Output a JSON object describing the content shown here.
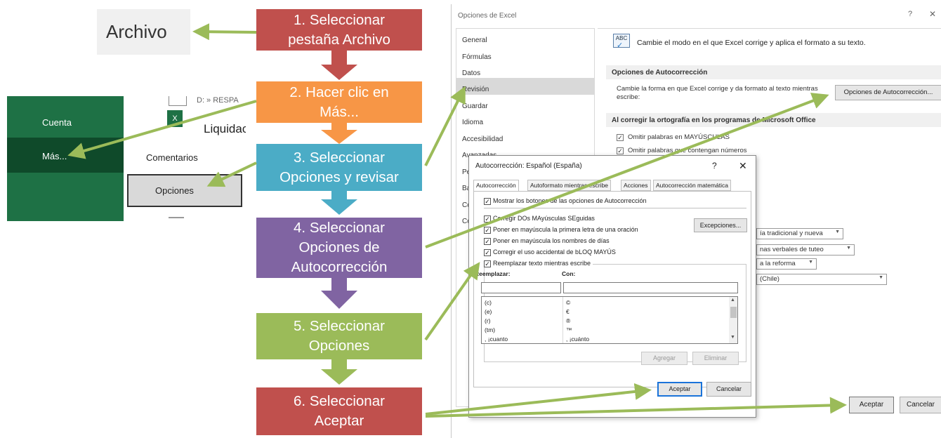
{
  "archivo": {
    "label": "Archivo"
  },
  "excel_menu": {
    "cuenta": "Cuenta",
    "mas": "Más...",
    "recent_path": "D: » RESPA",
    "recent_file": "Liquidac",
    "xl_icon": "X",
    "comentarios": "Comentarios",
    "opciones": "Opciones"
  },
  "steps": [
    {
      "lines": [
        "1. Seleccionar",
        "pestaña Archivo"
      ],
      "color": "#c0504d"
    },
    {
      "lines": [
        "2. Hacer clic en",
        "Más..."
      ],
      "color": "#f79646"
    },
    {
      "lines": [
        "3. Seleccionar",
        "Opciones y revisar"
      ],
      "color": "#4bacc6"
    },
    {
      "lines": [
        "4. Seleccionar",
        "Opciones de",
        "Autocorrección"
      ],
      "color": "#8064a2"
    },
    {
      "lines": [
        "5. Seleccionar",
        "Opciones"
      ],
      "color": "#9bbb59"
    },
    {
      "lines": [
        "6. Seleccionar",
        "Aceptar"
      ],
      "color": "#c0504d"
    }
  ],
  "arrow_color": "#9bbb59",
  "excel_options": {
    "title": "Opciones de Excel",
    "help": "?",
    "close": "✕",
    "nav": [
      "General",
      "Fórmulas",
      "Datos",
      "Revisión",
      "Guardar",
      "Idioma",
      "Accesibilidad",
      "Avanzadas",
      "Pe",
      "Ba",
      "Co",
      "Co"
    ],
    "selected_nav": "Revisión",
    "abc_icon": "ABC",
    "description": "Cambie el modo en el que Excel corrige y aplica el formato a su texto.",
    "section_autocorr": "Opciones de Autocorrección",
    "autocorr_desc": "Cambie la forma en que Excel corrige y da formato al texto mientras escribe:",
    "autocorr_button": "Opciones de Autocorrección...",
    "section_ortografia": "Al corregir la ortografía en los programas de Microsoft Office",
    "check_mayusculas": "Omitir palabras en MAYÚSCULAS",
    "check_numeros": "Omitir palabras que contengan números",
    "dropdown_1": "ía tradicional y nueva",
    "dropdown_2": "nas verbales de tuteo",
    "dropdown_3": "a la reforma",
    "dropdown_4": "(Chile)",
    "ok": "Aceptar",
    "cancel": "Cancelar"
  },
  "autocorrect_dialog": {
    "title": "Autocorrección: Español (España)",
    "help": "?",
    "close": "✕",
    "tabs": [
      "Autocorrección",
      "Autoformato mientras escribe",
      "Acciones",
      "Autocorrección matemática"
    ],
    "active_tab": "Autocorrección",
    "show_buttons": "Mostrar los botones de las opciones de Autocorrección",
    "checks": [
      "Corregir DOs MAyúsculas SEguidas",
      "Poner en mayúscula la primera letra de una oración",
      "Poner en mayúscula los nombres de días",
      "Corregir el uso accidental de bLOQ MAYÚS",
      "Reemplazar texto mientras escribe"
    ],
    "exceptions_button": "Excepciones...",
    "replace_label": "Reemplazar:",
    "with_label": "Con:",
    "rows": [
      {
        "replace": "(c)",
        "with": "©"
      },
      {
        "replace": "(e)",
        "with": "€"
      },
      {
        "replace": "(r)",
        "with": "®"
      },
      {
        "replace": "(tm)",
        "with": "™"
      },
      {
        "replace": ", ¡cuanto",
        "with": ", ¡cuánto"
      }
    ],
    "add_button": "Agregar",
    "delete_button": "Eliminar",
    "ok": "Aceptar",
    "cancel": "Cancelar"
  }
}
